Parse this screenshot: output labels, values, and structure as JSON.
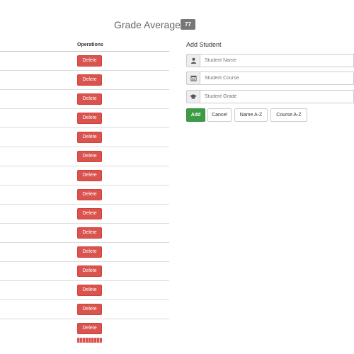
{
  "header": {
    "title": "Grade Average :",
    "average": "77"
  },
  "table": {
    "operations_header": "Operations",
    "delete_label": "Delete",
    "row_count": 15
  },
  "form": {
    "title": "Add Student",
    "fields": [
      {
        "icon": "user-icon",
        "placeholder": "Student Name"
      },
      {
        "icon": "calendar-icon",
        "placeholder": "Student Course"
      },
      {
        "icon": "graduation-cap-icon",
        "placeholder": "Student Grade"
      }
    ],
    "buttons": {
      "add": "Add",
      "cancel": "Cancel",
      "sort_name": "Name A-Z",
      "sort_course": "Course A-Z"
    }
  },
  "colors": {
    "danger": "#d9534f",
    "success": "#3c9c46",
    "badge": "#777777"
  }
}
